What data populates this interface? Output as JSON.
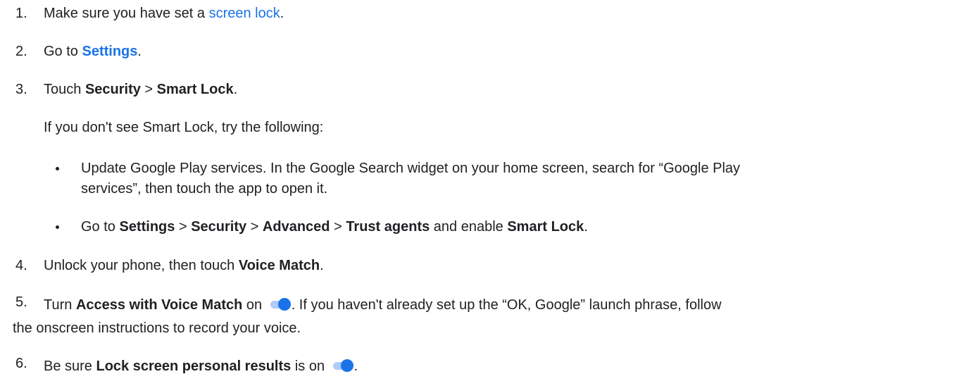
{
  "steps": [
    {
      "num": "1.",
      "pre": "Make sure you have set a ",
      "link": "screen lock",
      "post": "."
    },
    {
      "num": "2.",
      "pre": "Go to ",
      "link": "Settings",
      "post": "."
    },
    {
      "num": "3.",
      "pre": "Touch ",
      "b1": "Security",
      "mid": " > ",
      "b2": "Smart Lock",
      "post": "."
    },
    {
      "num": "4.",
      "pre": "Unlock your phone, then touch ",
      "b1": "Voice Match",
      "post": "."
    },
    {
      "num": "5.",
      "pre": "Turn ",
      "b1": "Access with Voice Match",
      "mid": " on ",
      "post": ". If you haven't already set up the “OK, Google” launch phrase, follow",
      "line2": "the onscreen instructions to record your voice."
    },
    {
      "num": "6.",
      "pre": "Be sure ",
      "b1": "Lock screen personal results",
      "mid": " is on ",
      "post": "."
    }
  ],
  "note": "If you don't see Smart Lock, try the following:",
  "bullets": [
    {
      "line1": "Update Google Play services. In the Google Search widget on your home screen, search for “Google Play",
      "line2": "services”, then touch the app to open it."
    },
    {
      "pre": "Go to ",
      "b1": "Settings",
      "s1": " > ",
      "b2": "Security",
      "s2": " > ",
      "b3": "Advanced",
      "s3": " > ",
      "b4": "Trust agents",
      "mid": " and enable ",
      "b5": "Smart Lock",
      "post": "."
    }
  ],
  "toggle_state": "on",
  "colors": {
    "link": "#1a73e8",
    "toggle_track": "#aecbfa",
    "toggle_knob": "#1a73e8",
    "text": "#202124"
  }
}
